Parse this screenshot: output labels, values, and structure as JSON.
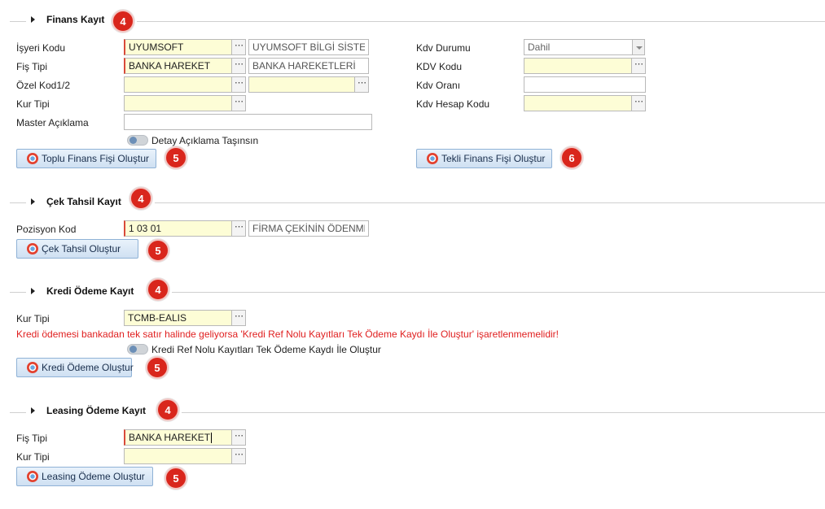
{
  "finans": {
    "title": "Finans Kayıt",
    "badge": "4",
    "isyeri_kodu": {
      "label": "İşyeri Kodu",
      "value": "UYUMSOFT",
      "desc": "UYUMSOFT BİLGİ SİSTEMl"
    },
    "fis_tipi": {
      "label": "Fiş Tipi",
      "value": "BANKA HAREKET",
      "desc": "BANKA HAREKETLERİ"
    },
    "ozel_kod": {
      "label": "Özel Kod1/2",
      "value1": "",
      "value2": ""
    },
    "kur_tipi": {
      "label": "Kur Tipi",
      "value": ""
    },
    "master_aciklama": {
      "label": "Master Açıklama",
      "value": ""
    },
    "detay_toggle_label": "Detay Açıklama Taşınsın",
    "kdv_durumu": {
      "label": "Kdv Durumu",
      "value": "Dahil"
    },
    "kdv_kodu": {
      "label": "KDV Kodu",
      "value": ""
    },
    "kdv_orani": {
      "label": "Kdv Oranı",
      "value": ""
    },
    "kdv_hesap_kodu": {
      "label": "Kdv Hesap Kodu",
      "value": ""
    },
    "toplu_button": "Toplu Finans Fişi Oluştur",
    "toplu_badge": "5",
    "tekli_button": "Tekli Finans Fişi Oluştur",
    "tekli_badge": "6"
  },
  "cek": {
    "title": "Çek Tahsil Kayıt",
    "badge": "4",
    "pozisyon_kod": {
      "label": "Pozisyon Kod",
      "value": "1 03 01",
      "desc": "FİRMA ÇEKİNİN ÖDENMES"
    },
    "button": "Çek Tahsil Oluştur",
    "button_badge": "5"
  },
  "kredi": {
    "title": "Kredi Ödeme Kayıt",
    "badge": "4",
    "kur_tipi": {
      "label": "Kur Tipi",
      "value": "TCMB-EALIS"
    },
    "warning": "Kredi ödemesi bankadan tek satır halinde geliyorsa 'Kredi Ref Nolu Kayıtları Tek Ödeme Kaydı İle Oluştur' işaretlenmemelidir!",
    "toggle_label": "Kredi Ref Nolu Kayıtları Tek Ödeme Kaydı İle Oluştur",
    "button": "Kredi Ödeme Oluştur",
    "button_badge": "5"
  },
  "leasing": {
    "title": "Leasing Ödeme Kayıt",
    "badge": "4",
    "fis_tipi": {
      "label": "Fiş Tipi",
      "value": "BANKA HAREKET"
    },
    "kur_tipi": {
      "label": "Kur Tipi",
      "value": ""
    },
    "button": "Leasing Ödeme Oluştur",
    "button_badge": "5"
  },
  "icons": {
    "section_toggle": "caret-right-icon",
    "lookup": "ellipsis-icon",
    "button": "gear-icon"
  },
  "colors": {
    "required_bg": "#fdfdd6",
    "badge": "#d9261c",
    "warning": "#e02020",
    "button_border": "#8fb2d6"
  }
}
